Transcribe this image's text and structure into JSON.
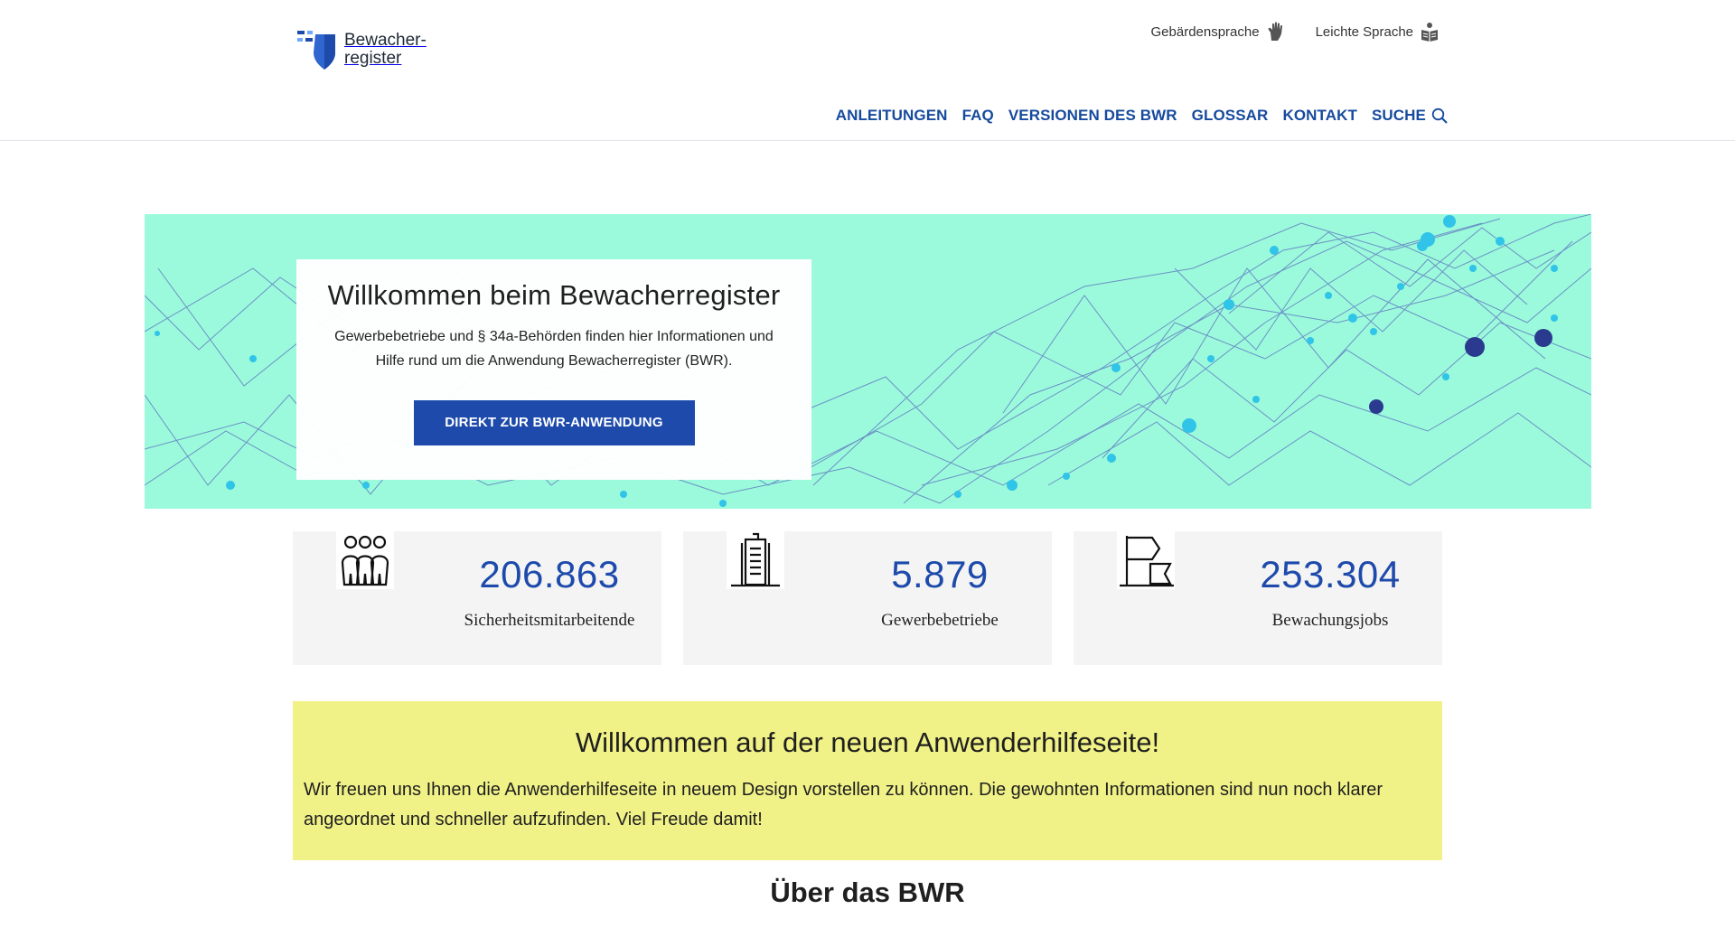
{
  "brand": {
    "name_line1": "Bewacher-",
    "name_line2": "register",
    "colors": {
      "primary": "#1d4aab",
      "nav": "#164a9e",
      "hero_bg": "#9bfadc",
      "notice_bg": "#f0f187"
    }
  },
  "utility_nav": {
    "sign_language": {
      "label": "Gebärdensprache",
      "icon": "hand-sign-icon"
    },
    "easy_language": {
      "label": "Leichte Sprache",
      "icon": "easy-language-book-icon"
    }
  },
  "main_nav": {
    "items": [
      {
        "label": "ANLEITUNGEN"
      },
      {
        "label": "FAQ"
      },
      {
        "label": "VERSIONEN DES BWR"
      },
      {
        "label": "GLOSSAR"
      },
      {
        "label": "KONTAKT"
      },
      {
        "label": "SUCHE"
      }
    ],
    "search_icon": "search-icon"
  },
  "hero": {
    "title": "Willkommen beim Bewacherregister",
    "subtitle": "Gewerbebetriebe und § 34a-Behörden finden hier Informationen und Hilfe rund um die Anwendung Bewacherregister (BWR).",
    "button_label": "DIREKT ZUR BWR-ANWENDUNG"
  },
  "stats": [
    {
      "value": "206.863",
      "label": "Sicherheitsmitarbeitende",
      "icon": "people-group-icon"
    },
    {
      "value": "5.879",
      "label": "Gewerbebetriebe",
      "icon": "building-icon"
    },
    {
      "value": "253.304",
      "label": "Bewachungsjobs",
      "icon": "flag-icon"
    }
  ],
  "notice": {
    "title": "Willkommen auf der neuen Anwenderhilfeseite!",
    "text": "Wir freuen uns Ihnen die Anwenderhilfeseite in neuem Design vorstellen zu können. Die gewohnten Informationen sind nun noch klarer angeordnet und schneller aufzufinden. Viel Freude damit!"
  },
  "section": {
    "title": "Über das BWR"
  }
}
